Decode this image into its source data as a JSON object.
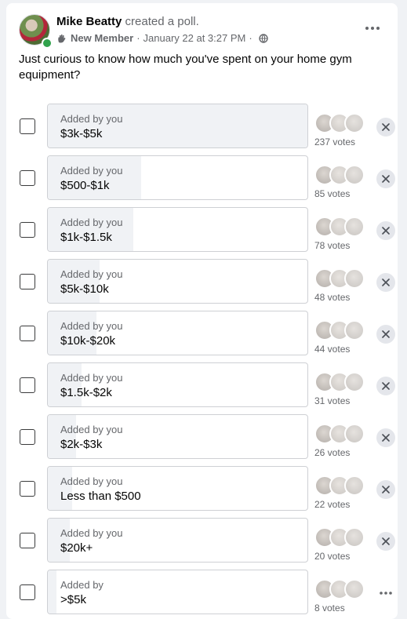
{
  "post": {
    "author": "Mike Beatty",
    "action": "created a poll.",
    "badge": "New Member",
    "date": "January 22 at 3:27 PM",
    "separator": "·",
    "question": "Just curious to know how much you've spent on your home gym equipment?"
  },
  "colors": {
    "online": "#31a24c",
    "fill": "#f0f2f5",
    "secondary_text": "#65676b"
  },
  "options": [
    {
      "label": "$3k-$5k",
      "added_by": "Added by you",
      "votes": "237 votes",
      "fill_fraction": 1.0,
      "action": "remove"
    },
    {
      "label": "$500-$1k",
      "added_by": "Added by you",
      "votes": "85 votes",
      "fill_fraction": 0.36,
      "action": "remove"
    },
    {
      "label": "$1k-$1.5k",
      "added_by": "Added by you",
      "votes": "78 votes",
      "fill_fraction": 0.33,
      "action": "remove"
    },
    {
      "label": "$5k-$10k",
      "added_by": "Added by you",
      "votes": "48 votes",
      "fill_fraction": 0.2,
      "action": "remove"
    },
    {
      "label": "$10k-$20k",
      "added_by": "Added by you",
      "votes": "44 votes",
      "fill_fraction": 0.186,
      "action": "remove"
    },
    {
      "label": "$1.5k-$2k",
      "added_by": "Added by you",
      "votes": "31 votes",
      "fill_fraction": 0.131,
      "action": "remove"
    },
    {
      "label": "$2k-$3k",
      "added_by": "Added by you",
      "votes": "26 votes",
      "fill_fraction": 0.11,
      "action": "remove"
    },
    {
      "label": "Less than $500",
      "added_by": "Added by you",
      "votes": "22 votes",
      "fill_fraction": 0.093,
      "action": "remove"
    },
    {
      "label": "$20k+",
      "added_by": "Added by you",
      "votes": "20 votes",
      "fill_fraction": 0.084,
      "action": "remove"
    },
    {
      "label": ">$5k",
      "added_by": "Added by",
      "votes": "8 votes",
      "fill_fraction": 0.034,
      "action": "more"
    }
  ],
  "icons": {
    "more": "more-horizontal-icon",
    "remove": "close-icon",
    "privacy": "globe-icon",
    "badge": "waving-hand-icon"
  }
}
